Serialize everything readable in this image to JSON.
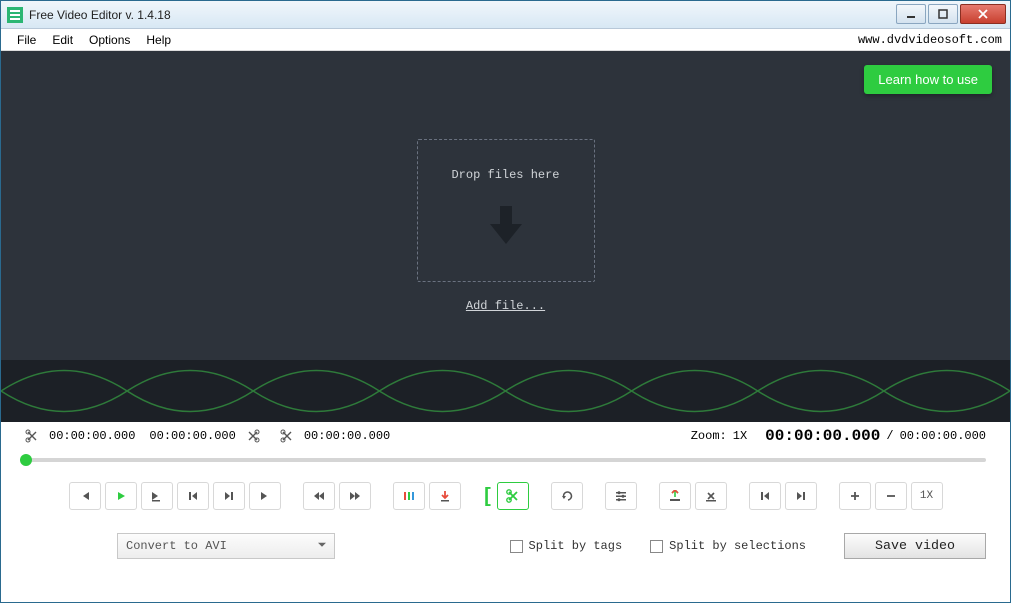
{
  "window": {
    "title": "Free Video Editor v. 1.4.18"
  },
  "menu": {
    "file": "File",
    "edit": "Edit",
    "options": "Options",
    "help": "Help",
    "url": "www.dvdvideosoft.com"
  },
  "learn_btn": "Learn how to use",
  "dropzone": {
    "text": "Drop files here",
    "addfile": "Add file..."
  },
  "timebar": {
    "start": "00:00:00.000",
    "end": "00:00:00.000",
    "duration": "00:00:00.000",
    "zoom_label": "Zoom:",
    "zoom": "1X",
    "current": "00:00:00.000",
    "slash": "/",
    "total": "00:00:00.000"
  },
  "toolbar": {
    "speed": "1X"
  },
  "bottom": {
    "convert": "Convert to AVI",
    "split_tags": "Split by tags",
    "split_sel": "Split by selections",
    "save": "Save video"
  }
}
